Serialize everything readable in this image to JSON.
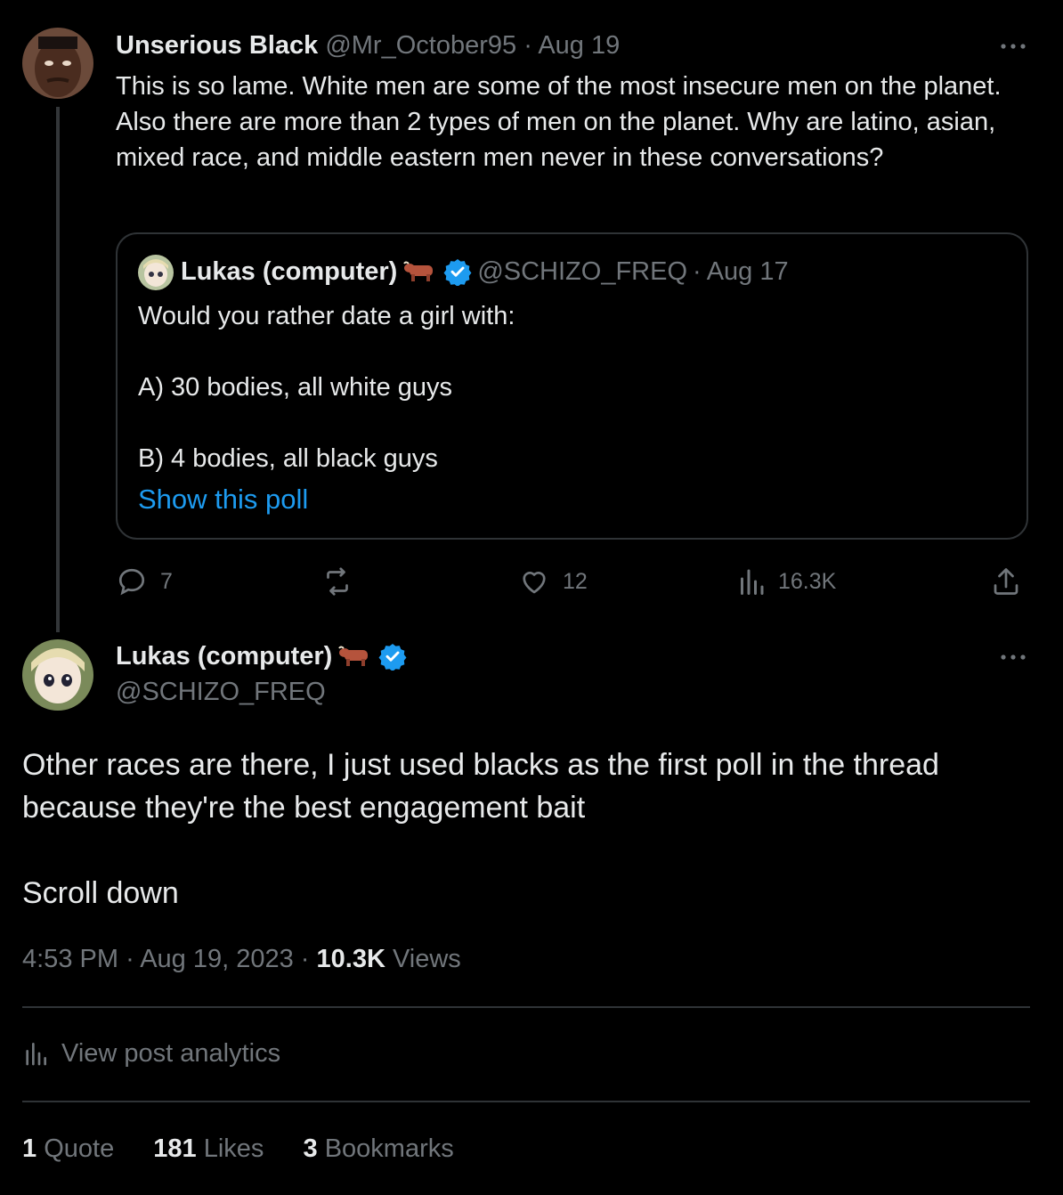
{
  "parent": {
    "name": "Unserious Black",
    "handle": "@Mr_October95",
    "date": "Aug 19",
    "text": "This is so lame. White men are some of the most insecure men on the planet. Also there are more than 2 types of men on the planet. Why are latino, asian, mixed race, and middle eastern men never in these conversations?",
    "quote": {
      "name": "Lukas (computer)",
      "handle": "@SCHIZO_FREQ",
      "date": "Aug 17",
      "line1": "Would you rather date a girl with:",
      "line2": "A) 30 bodies, all white guys",
      "line3": "B) 4 bodies, all black guys",
      "show_poll": "Show this poll"
    },
    "actions": {
      "replies": "7",
      "reposts": "",
      "likes": "12",
      "views": "16.3K"
    }
  },
  "main": {
    "name": "Lukas (computer)",
    "handle": "@SCHIZO_FREQ",
    "text_line1": "Other races are there, I just used blacks as the first poll in the thread because they're the best engagement bait",
    "text_line2": "Scroll down",
    "time": "4:53 PM",
    "date": "Aug 19, 2023",
    "views_count": "10.3K",
    "views_label": "Views",
    "analytics_label": "View post analytics",
    "stats": {
      "quotes_count": "1",
      "quotes_label": "Quote",
      "likes_count": "181",
      "likes_label": "Likes",
      "bookmarks_count": "3",
      "bookmarks_label": "Bookmarks"
    }
  },
  "colors": {
    "background": "#000000",
    "text": "#e7e9ea",
    "muted": "#71767b",
    "link": "#1d9bf0",
    "verified": "#1d9bf0",
    "border": "#2f3336"
  },
  "icons": [
    "more-icon",
    "ox-emoji-icon",
    "verified-badge-icon",
    "reply-icon",
    "repost-icon",
    "like-icon",
    "views-icon",
    "share-icon",
    "analytics-icon"
  ]
}
